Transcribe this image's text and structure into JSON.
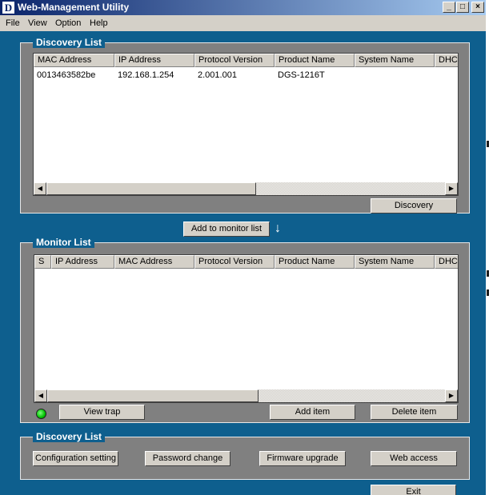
{
  "window": {
    "logo": "D",
    "title": "Web-Management Utility",
    "controls": {
      "minimize": "_",
      "maximize": "□",
      "close": "×"
    }
  },
  "menu": [
    "File",
    "View",
    "Option",
    "Help"
  ],
  "discovery_list": {
    "title": "Discovery List",
    "columns": [
      "MAC Address",
      "IP Address",
      "Protocol Version",
      "Product Name",
      "System Name",
      "DHCP"
    ],
    "rows": [
      [
        "0013463582be",
        "192.168.1.254",
        "2.001.001",
        "DGS-1216T",
        "",
        ""
      ]
    ],
    "discovery_button": "Discovery"
  },
  "add_to_monitor_button": "Add to monitor list",
  "add_arrow_icon": "arrow-down-icon",
  "monitor_list": {
    "title": "Monitor List",
    "columns": [
      "S",
      "IP Address",
      "MAC Address",
      "Protocol Version",
      "Product Name",
      "System Name",
      "DHCP"
    ],
    "rows": [],
    "status_led_color": "#00c000",
    "view_trap_button": "View trap",
    "add_item_button": "Add item",
    "delete_item_button": "Delete item"
  },
  "actions_group": {
    "title": "Discovery List",
    "configuration_button": "Configuration setting",
    "password_button": "Password change",
    "firmware_button": "Firmware upgrade",
    "web_access_button": "Web access"
  },
  "exit_button": "Exit",
  "colors": {
    "background": "#0e5f8e",
    "group_fill": "#808080",
    "titlebar": "#0a246a"
  },
  "scroll_icons": {
    "left": "◀",
    "right": "▶"
  }
}
